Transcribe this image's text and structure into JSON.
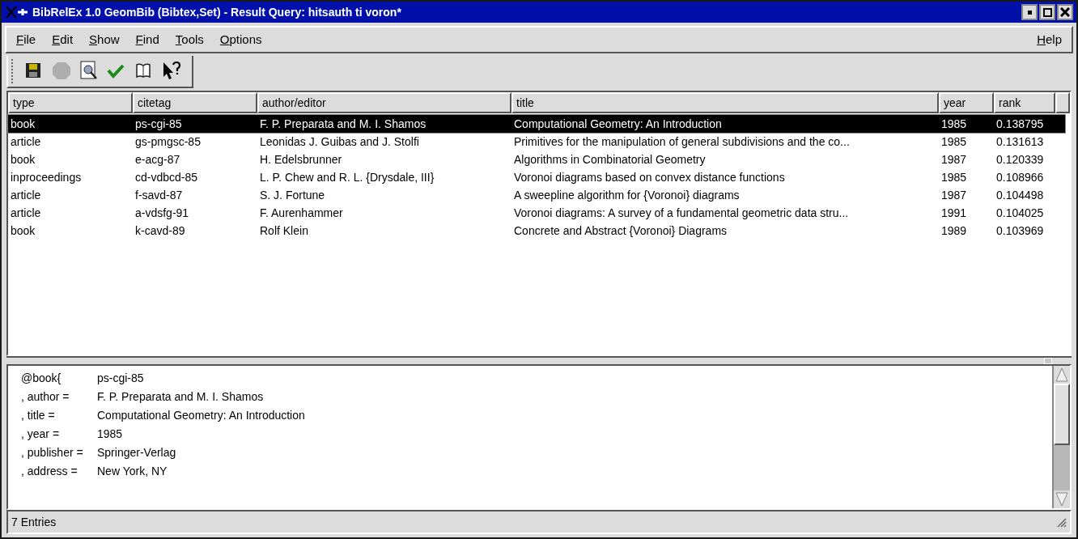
{
  "window": {
    "title": "BibRelEx 1.0 GeomBib (Bibtex,Set) - Result Query: hitsauth ti voron*"
  },
  "menu": [
    "File",
    "Edit",
    "Show",
    "Find",
    "Tools",
    "Options"
  ],
  "help_menu": "Help",
  "toolbar": [
    {
      "kind": "save",
      "disabled": false
    },
    {
      "kind": "stop",
      "disabled": true
    },
    {
      "kind": "inspect",
      "disabled": false
    },
    {
      "kind": "check",
      "disabled": false
    },
    {
      "kind": "book",
      "disabled": false
    },
    {
      "kind": "whatsthis",
      "disabled": false
    }
  ],
  "table": {
    "columns": [
      "type",
      "citetag",
      "author/editor",
      "title",
      "year",
      "rank"
    ],
    "rows": [
      {
        "cells": [
          "book",
          "ps-cgi-85",
          "F. P. Preparata and M. I. Shamos",
          "Computational Geometry: An Introduction",
          "1985",
          "0.138795"
        ],
        "selected": true
      },
      {
        "cells": [
          "article",
          "gs-pmgsc-85",
          "Leonidas J. Guibas and J. Stolfi",
          "Primitives for the manipulation of general subdivisions and the co...",
          "1985",
          "0.131613"
        ],
        "selected": false
      },
      {
        "cells": [
          "book",
          "e-acg-87",
          "H. Edelsbrunner",
          "Algorithms in Combinatorial Geometry",
          "1987",
          "0.120339"
        ],
        "selected": false
      },
      {
        "cells": [
          "inproceedings",
          "cd-vdbcd-85",
          "L. P. Chew and R. L. {Drysdale, III}",
          "Voronoi diagrams based on convex distance functions",
          "1985",
          "0.108966"
        ],
        "selected": false
      },
      {
        "cells": [
          "article",
          "f-savd-87",
          "S. J. Fortune",
          "A sweepline algorithm for {Voronoi} diagrams",
          "1987",
          "0.104498"
        ],
        "selected": false
      },
      {
        "cells": [
          "article",
          "a-vdsfg-91",
          "F. Aurenhammer",
          "Voronoi diagrams: A survey of a fundamental geometric data stru...",
          "1991",
          "0.104025"
        ],
        "selected": false
      },
      {
        "cells": [
          "book",
          "k-cavd-89",
          "Rolf Klein",
          "Concrete and Abstract {Voronoi} Diagrams",
          "1989",
          "0.103969"
        ],
        "selected": false
      }
    ]
  },
  "detail": [
    {
      "key": "@book{",
      "value": "ps-cgi-85"
    },
    {
      "key": ", author =",
      "value": "F. P. Preparata and M. I. Shamos"
    },
    {
      "key": ", title =",
      "value": "Computational Geometry: An Introduction"
    },
    {
      "key": ", year =",
      "value": "1985"
    },
    {
      "key": ", publisher =",
      "value": "Springer-Verlag"
    },
    {
      "key": ", address =",
      "value": "New York, NY"
    }
  ],
  "status_bar": "7 Entries"
}
